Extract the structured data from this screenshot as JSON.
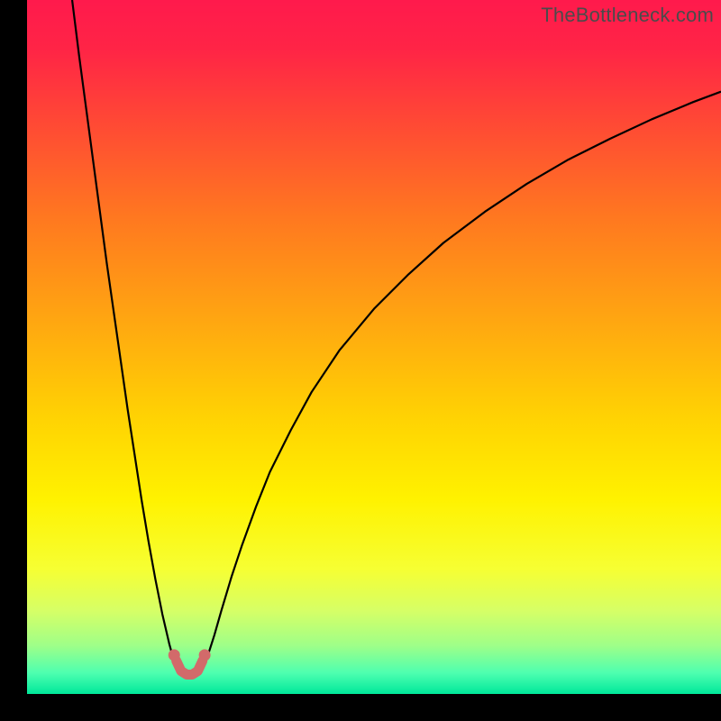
{
  "watermark": "TheBottleneck.com",
  "chart_data": {
    "type": "line",
    "title": "",
    "xlabel": "",
    "ylabel": "",
    "xlim": [
      0,
      100
    ],
    "ylim": [
      0,
      100
    ],
    "background_gradient_stops": [
      {
        "pos": 0.0,
        "color": "#ff1a4c"
      },
      {
        "pos": 0.07,
        "color": "#ff2446"
      },
      {
        "pos": 0.18,
        "color": "#ff4a34"
      },
      {
        "pos": 0.32,
        "color": "#ff7a1f"
      },
      {
        "pos": 0.47,
        "color": "#ffa910"
      },
      {
        "pos": 0.6,
        "color": "#ffd203"
      },
      {
        "pos": 0.72,
        "color": "#fff200"
      },
      {
        "pos": 0.82,
        "color": "#f6ff33"
      },
      {
        "pos": 0.88,
        "color": "#d6ff66"
      },
      {
        "pos": 0.93,
        "color": "#9fff88"
      },
      {
        "pos": 0.97,
        "color": "#4dffb0"
      },
      {
        "pos": 1.0,
        "color": "#00e89a"
      }
    ],
    "series": [
      {
        "name": "left-branch",
        "stroke": "#000000",
        "stroke_width": 2.2,
        "x": [
          6.5,
          7.5,
          8.5,
          9.5,
          10.5,
          11.5,
          12.5,
          13.5,
          14.5,
          15.5,
          16.5,
          17.5,
          18.5,
          19.5,
          20.5,
          21.0,
          21.5,
          22.0
        ],
        "y": [
          100,
          92,
          84.5,
          77,
          69.5,
          62,
          55,
          48,
          41,
          34.5,
          28,
          22,
          16.5,
          11.5,
          7.2,
          5.4,
          4.2,
          3.6
        ]
      },
      {
        "name": "right-branch",
        "stroke": "#000000",
        "stroke_width": 2.2,
        "x": [
          25.0,
          25.6,
          26.2,
          27,
          28,
          29.5,
          31,
          33,
          35,
          38,
          41,
          45,
          50,
          55,
          60,
          66,
          72,
          78,
          84,
          90,
          96,
          100
        ],
        "y": [
          3.6,
          4.5,
          6.0,
          8.5,
          12,
          17,
          21.5,
          27,
          32,
          38,
          43.5,
          49.5,
          55.5,
          60.5,
          65,
          69.5,
          73.5,
          77,
          80,
          82.8,
          85.3,
          86.8
        ]
      },
      {
        "name": "valley-floor",
        "stroke": "#d26a6a",
        "stroke_width": 11,
        "linecap": "round",
        "x": [
          21.5,
          22.2,
          23.0,
          23.8,
          24.6,
          25.3
        ],
        "y": [
          4.8,
          3.3,
          2.8,
          2.8,
          3.3,
          4.8
        ]
      }
    ],
    "markers": [
      {
        "name": "left-endpoint",
        "x": 21.2,
        "y": 5.6,
        "r": 6.5,
        "fill": "#d26a6a"
      },
      {
        "name": "right-endpoint",
        "x": 25.6,
        "y": 5.6,
        "r": 6.5,
        "fill": "#d26a6a"
      }
    ]
  }
}
